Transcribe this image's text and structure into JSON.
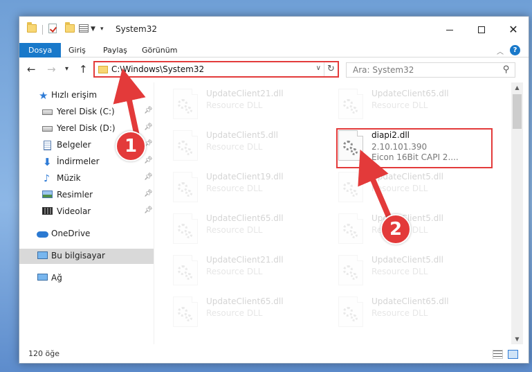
{
  "window": {
    "title": "System32"
  },
  "ribbon": {
    "tabs": [
      {
        "label": "Dosya",
        "active": true
      },
      {
        "label": "Giriş",
        "active": false
      },
      {
        "label": "Paylaş",
        "active": false
      },
      {
        "label": "Görünüm",
        "active": false
      }
    ],
    "help_label": "?"
  },
  "nav": {
    "address": "C:\\Windows\\System32",
    "search_placeholder": "Ara: System32"
  },
  "sidebar": {
    "items": [
      {
        "label": "Hızlı erişim",
        "icon": "star-icon",
        "pinned": false
      },
      {
        "label": "Yerel Disk (C:)",
        "icon": "drive-icon",
        "pinned": true
      },
      {
        "label": "Yerel Disk (D:)",
        "icon": "drive-icon",
        "pinned": true
      },
      {
        "label": "Belgeler",
        "icon": "document-icon",
        "pinned": true
      },
      {
        "label": "İndirmeler",
        "icon": "download-icon",
        "pinned": true
      },
      {
        "label": "Müzik",
        "icon": "music-icon",
        "pinned": true
      },
      {
        "label": "Resimler",
        "icon": "pictures-icon",
        "pinned": true
      },
      {
        "label": "Videolar",
        "icon": "video-icon",
        "pinned": true
      },
      {
        "label": "OneDrive",
        "icon": "onedrive-icon",
        "pinned": false
      },
      {
        "label": "Bu bilgisayar",
        "icon": "computer-icon",
        "pinned": false,
        "selected": true
      },
      {
        "label": "Ağ",
        "icon": "network-icon",
        "pinned": false
      }
    ]
  },
  "files": {
    "left": [
      {
        "name": "UpdateClient21.dll",
        "type": "Resource DLL"
      },
      {
        "name": "UpdateClient5.dll",
        "type": "Resource DLL"
      },
      {
        "name": "UpdateClient19.dll",
        "type": "Resource DLL"
      },
      {
        "name": "UpdateClient65.dll",
        "type": "Resource DLL"
      },
      {
        "name": "UpdateClient21.dll",
        "type": "Resource DLL"
      },
      {
        "name": "UpdateClient65.dll",
        "type": "Resource DLL"
      }
    ],
    "right": [
      {
        "name": "UpdateClient65.dll",
        "type": "Resource DLL"
      },
      {
        "name": "diapi2.dll",
        "version": "2.10.101.390",
        "description": "Eicon 16Bit CAPI 2....",
        "highlighted": true
      },
      {
        "name": "UpdateClient5.dll",
        "type": "Resource DLL"
      },
      {
        "name": "UpdateClient5.dll",
        "type": "Resource DLL"
      },
      {
        "name": "UpdateClient5.dll",
        "type": "Resource DLL"
      },
      {
        "name": "UpdateClient65.dll",
        "type": "Resource DLL"
      }
    ]
  },
  "status": {
    "item_count": "120 öğe"
  },
  "annotations": {
    "badge1": "1",
    "badge2": "2",
    "accent": "#e33a3a"
  }
}
